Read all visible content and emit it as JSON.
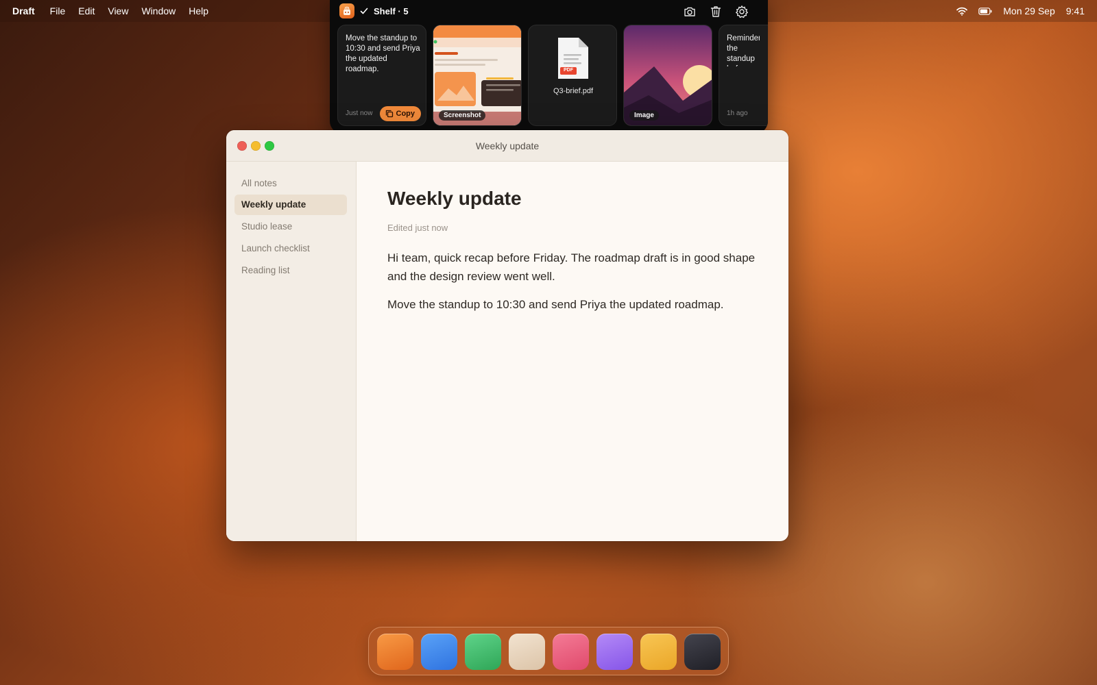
{
  "menubar": {
    "app_name": "Draft",
    "menus": [
      "File",
      "Edit",
      "View",
      "Window",
      "Help"
    ],
    "date": "Mon 29 Sep",
    "time": "9:41",
    "icons": [
      "wifi-icon",
      "battery-icon"
    ]
  },
  "shelf": {
    "title": "Shelf · 5",
    "tools": [
      "camera-icon",
      "trash-icon",
      "gear-icon"
    ],
    "cards": [
      {
        "kind": "text",
        "text": "Move the standup to 10:30 and send Priya the updated roadmap.",
        "time": "Just now",
        "action": "Copy"
      },
      {
        "kind": "screenshot",
        "badge": "Screenshot"
      },
      {
        "kind": "file",
        "badge": "PDF",
        "filename": "Q3-brief.pdf"
      },
      {
        "kind": "image",
        "badge": "Image"
      },
      {
        "kind": "text",
        "text": "Reminder: the standup before",
        "time": "1h ago"
      }
    ]
  },
  "window": {
    "title": "Weekly update",
    "sidebar": [
      "All notes",
      "Weekly update",
      "Studio lease",
      "Launch checklist",
      "Reading list"
    ],
    "active_item": "Weekly update",
    "note": {
      "title": "Weekly update",
      "meta": "Edited just now",
      "paragraphs": [
        "Hi team, quick recap before Friday. The roadmap draft is in good shape and the design review went well.",
        "Move the standup to 10:30 and send Priya the updated roadmap."
      ]
    }
  },
  "dock": {
    "apps": [
      "orange-app",
      "blue-app",
      "green-app",
      "beige-app",
      "pink-app",
      "purple-app",
      "yellow-app",
      "dark-app"
    ],
    "colors": [
      "#f07d2a",
      "#3d86f0",
      "#3dbd6a",
      "#e9d7c0",
      "#ea5a7c",
      "#9a67ef",
      "#f2b63c",
      "#2e2e36"
    ]
  },
  "colors": {
    "accent": "#f0893a",
    "close": "#ee5f57",
    "minimize": "#f5bd2f",
    "zoom": "#2ec843"
  }
}
